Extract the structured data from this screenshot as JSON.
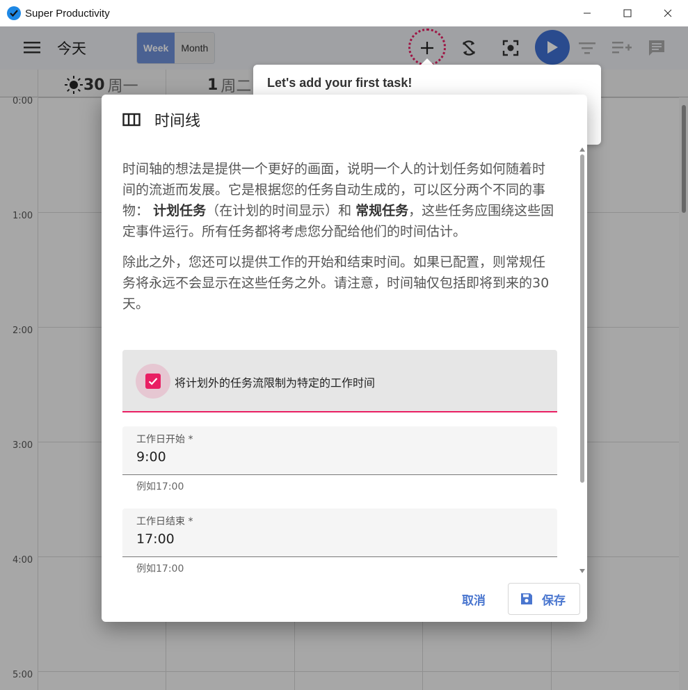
{
  "window": {
    "title": "Super Productivity",
    "controls": [
      "minimize-icon",
      "maximize-icon",
      "close-icon"
    ]
  },
  "toolbar": {
    "page_title": "今天",
    "view_toggle": {
      "week_label": "Week",
      "month_label": "Month",
      "active": "Week"
    },
    "icons": [
      "menu-icon",
      "add-icon",
      "sync-icon",
      "focus-icon",
      "play-icon",
      "filter-icon",
      "playlist-add-icon",
      "comment-icon"
    ]
  },
  "calendar": {
    "days": [
      {
        "num": "30",
        "weekday": "周一"
      },
      {
        "num": "1",
        "weekday": "周二"
      }
    ],
    "hours": [
      "0:00",
      "1:00",
      "2:00",
      "3:00",
      "4:00",
      "5:00"
    ]
  },
  "tour": {
    "text": "Let's add your first task!"
  },
  "dialog": {
    "title": "时间线",
    "para1_a": "时间轴的想法是提供一个更好的画面，说明一个人的计划任务如何随着时间的流逝而发展。它是根据您的任务自动生成的，可以区分两个不同的事物：",
    "para1_b": "计划任务",
    "para1_c": "（在计划的时间显示）和",
    "para1_d": "常规任务",
    "para1_e": "，这些任务应围绕这些固定事件运行。所有任务都将考虑您分配给他们的时间估计。",
    "para2": "除此之外，您还可以提供工作的开始和结束时间。如果已配置，则常规任务将永远不会显示在这些任务之外。请注意，时间轴仅包括即将到来的30天。",
    "checkbox_label": "将计划外的任务流限制为特定的工作时间",
    "checkbox_checked": true,
    "work_start": {
      "label": "工作日开始 *",
      "value": "9:00",
      "hint": "例如17:00"
    },
    "work_end": {
      "label": "工作日结束 *",
      "value": "17:00",
      "hint": "例如17:00"
    },
    "cancel_label": "取消",
    "save_label": "保存"
  },
  "colors": {
    "accent": "#e91e63",
    "primary": "#4a76cf",
    "play": "#3f6fd1"
  }
}
